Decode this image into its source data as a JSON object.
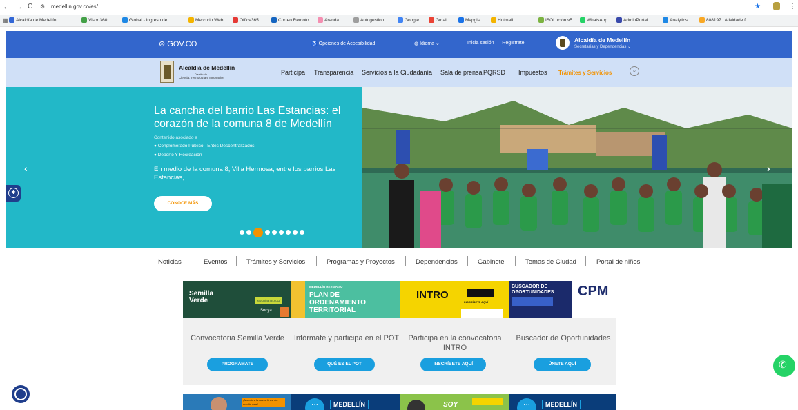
{
  "browser": {
    "url": "medellin.gov.co/es/",
    "bookmarks": [
      "Alcaldía de Medellín",
      "Visor 360",
      "Global - Ingreso de...",
      "Mercurio Web",
      "Office365",
      "Correo Remoto",
      "Aranda",
      "Autogestion",
      "Google",
      "Gmail",
      "Mapgis",
      "Hotmail",
      "ISOLución v5",
      "WhatsApp",
      "AdminPortal",
      "Analytics",
      "808197 | Atividade f..."
    ]
  },
  "gov_bar": {
    "logo": "GOV.CO",
    "accessibility": "Opciones de Accesibilidad",
    "language": "Idioma",
    "login": "Inicia sesión",
    "divider": "|",
    "register": "Regístrate",
    "org_title": "Alcaldía de Medellín",
    "org_sub": "Secretarías y Dependencias"
  },
  "nav": {
    "brand_title": "Alcaldía de Medellín",
    "brand_sub1": "Distrito de",
    "brand_sub2": "Ciencia, Tecnología e Innovación",
    "items": [
      "Participa",
      "Transparencia",
      "Servicios a la Ciudadanía",
      "Sala de prensa",
      "PQRSD",
      "Impuestos",
      "Trámites y Servicios"
    ],
    "active_color": "#f39200"
  },
  "hero": {
    "title": "La cancha del barrio Las Estancias: el corazón de la comuna 8 de Medellín",
    "assoc_label": "Contenido asociado a",
    "assoc_items": [
      "Conglomerado Público - Entes Descentralizados",
      "Deporte Y Recreación"
    ],
    "excerpt": "En medio de la comuna 8, Villa Hermosa, entre los barrios Las Estancias,...",
    "cta": "CONOCE MÁS",
    "slide_count": 9,
    "active_slide": 3
  },
  "subnav": [
    "Noticias",
    "Eventos",
    "Trámites y Servicios",
    "Programas y Proyectos",
    "Dependencias",
    "Gabinete",
    "Temas de Ciudad",
    "Portal de niños"
  ],
  "cards": [
    {
      "banner_title": "Semilla Verde",
      "banner_tag": "INSCRÍBETE AQUÍ",
      "banner_brand": "Socya",
      "title": "Convocatoria Semilla Verde",
      "button": "PROGRÁMATE"
    },
    {
      "banner_title": "PLAN DE ORDENAMIENTO TERRITORIAL",
      "banner_tag": "MEDELLÍN REVISA SU",
      "title": "Infórmate y participa en el POT",
      "button": "QUÉ ES EL POT"
    },
    {
      "banner_title": "INTRO",
      "banner_tag": "INSCRÍBETE AQUÍ",
      "title": "Participa en la convocatoria INTRO",
      "button": "INSCRÍBETE AQUÍ"
    },
    {
      "banner_title": "BUSCADOR DE OPORTUNIDADES",
      "banner_brand": "CPM",
      "title": "Buscador de Oportunidades",
      "button": "ÚNETE AQUÍ"
    }
  ],
  "row2": [
    {
      "text": "¡Accede a la nueva línea de crédito rural!"
    },
    {
      "text": "MEDELLÍN"
    },
    {
      "text": "SOY"
    },
    {
      "text": "MEDELLÍN"
    }
  ],
  "colors": {
    "gov_blue": "#3366cc",
    "nav_bg": "#d0e0f7",
    "hero_teal": "#22b8c8",
    "accent_orange": "#f39200",
    "btn_blue": "#1a9fdf",
    "whatsapp_green": "#25d366"
  }
}
